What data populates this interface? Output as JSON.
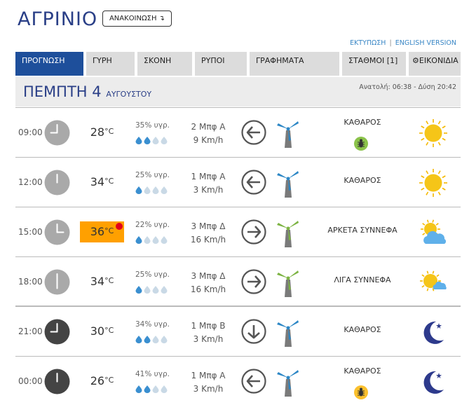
{
  "header": {
    "city": "ΑΓΡΙΝΙΟ",
    "announce_label": "ΑΝΑΚΟΙΝΩΣΗ ↴",
    "print_link": "ΕΚΤΥΠΩΣΗ",
    "link_separator": "|",
    "english_link": "ENGLISH VERSION"
  },
  "tabs": [
    {
      "label": "ΠΡΟΓΝΩΣΗ",
      "active": true
    },
    {
      "label": "ΓΥΡΗ",
      "active": false
    },
    {
      "label": "ΣΚΟΝΗ",
      "active": false
    },
    {
      "label": "ΡΥΠΟΙ",
      "active": false
    },
    {
      "label": "ΓΡΑΦΗΜΑΤΑ",
      "active": false
    },
    {
      "label": "ΣΤΑΘΜΟΙ [1]",
      "active": false
    },
    {
      "label": "ΕΙΚΟΝΙΔΙΑ",
      "active": false,
      "icon": "gear-icon"
    }
  ],
  "day": {
    "name": "ΠΕΜΠΤΗ 4",
    "month": "ΑΥΓΟΥΣΤΟΥ",
    "sun_times": "Ανατολή: 06:38  - Δύση 20:42"
  },
  "rows": [
    {
      "time": "09:00",
      "clock": "day",
      "temp": "28",
      "deg": "°C",
      "hot": false,
      "humidity": "35% υγρ.",
      "drops_filled": 2,
      "drops_total": 4,
      "wind_force": "2 Μπφ Α",
      "wind_speed": "9 Km/h",
      "wind_dir": "west",
      "mill_color": "#2b86c5",
      "condition": "ΚΑΘΑΡΟΣ",
      "bug": true,
      "bug_color": "#8bc34a",
      "weather_icon": "sun-icon"
    },
    {
      "time": "12:00",
      "clock": "day",
      "temp": "34",
      "deg": "°C",
      "hot": false,
      "humidity": "25% υγρ.",
      "drops_filled": 1,
      "drops_total": 4,
      "wind_force": "1 Μπφ Α",
      "wind_speed": "3 Km/h",
      "wind_dir": "west",
      "mill_color": "#2b86c5",
      "condition": "ΚΑΘΑΡΟΣ",
      "bug": false,
      "weather_icon": "sun-icon"
    },
    {
      "time": "15:00",
      "clock": "day",
      "temp": "36",
      "deg": "°C",
      "hot": true,
      "humidity": "22% υγρ.",
      "drops_filled": 1,
      "drops_total": 4,
      "wind_force": "3 Μπφ Δ",
      "wind_speed": "16 Km/h",
      "wind_dir": "east",
      "mill_color": "#7cb342",
      "condition": "ΑΡΚΕΤΑ ΣΥΝΝΕΦΑ",
      "bug": false,
      "weather_icon": "sun-cloud-icon"
    },
    {
      "time": "18:00",
      "clock": "day",
      "temp": "34",
      "deg": "°C",
      "hot": false,
      "humidity": "25% υγρ.",
      "drops_filled": 1,
      "drops_total": 4,
      "wind_force": "3 Μπφ Δ",
      "wind_speed": "16 Km/h",
      "wind_dir": "east",
      "mill_color": "#7cb342",
      "condition": "ΛΙΓΑ ΣΥΝΝΕΦΑ",
      "bug": false,
      "weather_icon": "sun-small-cloud-icon"
    },
    {
      "time": "21:00",
      "clock": "night",
      "temp": "30",
      "deg": "°C",
      "hot": false,
      "humidity": "34% υγρ.",
      "drops_filled": 2,
      "drops_total": 4,
      "wind_force": "1 Μπφ Β",
      "wind_speed": "3 Km/h",
      "wind_dir": "south",
      "mill_color": "#2b86c5",
      "condition": "ΚΑΘΑΡΟΣ",
      "bug": false,
      "weather_icon": "moon-icon"
    },
    {
      "time": "00:00",
      "clock": "night",
      "temp": "26",
      "deg": "°C",
      "hot": false,
      "humidity": "41% υγρ.",
      "drops_filled": 2,
      "drops_total": 4,
      "wind_force": "1 Μπφ Α",
      "wind_speed": "3 Km/h",
      "wind_dir": "west",
      "mill_color": "#2b86c5",
      "condition": "ΚΑΘΑΡΟΣ",
      "bug": true,
      "bug_color": "#fbc02d",
      "weather_icon": "moon-icon"
    }
  ],
  "colors": {
    "brand_blue": "#2a3f87",
    "active_tab": "#1e4f9b",
    "link": "#3a87c6",
    "hot_temp": "#ffa000",
    "alert_dot": "#e3001b",
    "drop_filled": "#3a8fd0",
    "drop_empty": "#c9d9e6"
  }
}
